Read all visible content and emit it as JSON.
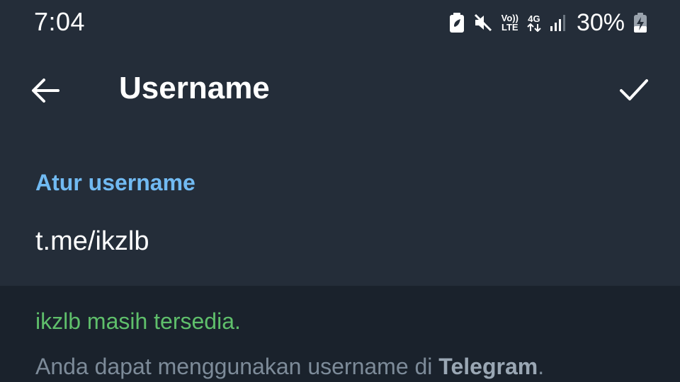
{
  "status_bar": {
    "time": "7:04",
    "network_top": "Vo))",
    "network_bottom": "LTE",
    "data_type": "4G",
    "battery_percent": "30%",
    "icons": [
      "battery-saver-icon",
      "mute-icon",
      "volte-icon",
      "4g-data-icon",
      "signal-icon",
      "battery-charging-icon"
    ]
  },
  "app_bar": {
    "back_icon": "arrow-left-icon",
    "title": "Username",
    "confirm_icon": "check-icon"
  },
  "form": {
    "section_header": "Atur username",
    "username_value": "t.me/ikzlb"
  },
  "info": {
    "availability_message": "ikzlb masih tersedia.",
    "hint_prefix": "Anda dapat menggunakan username di ",
    "hint_bold": "Telegram",
    "hint_suffix": "."
  },
  "colors": {
    "background": "#1d2733",
    "bar": "#242d39",
    "info_bg": "#1a222c",
    "accent_blue": "#71baf2",
    "success_green": "#5fbf6b",
    "hint_gray": "#7d8b99"
  }
}
